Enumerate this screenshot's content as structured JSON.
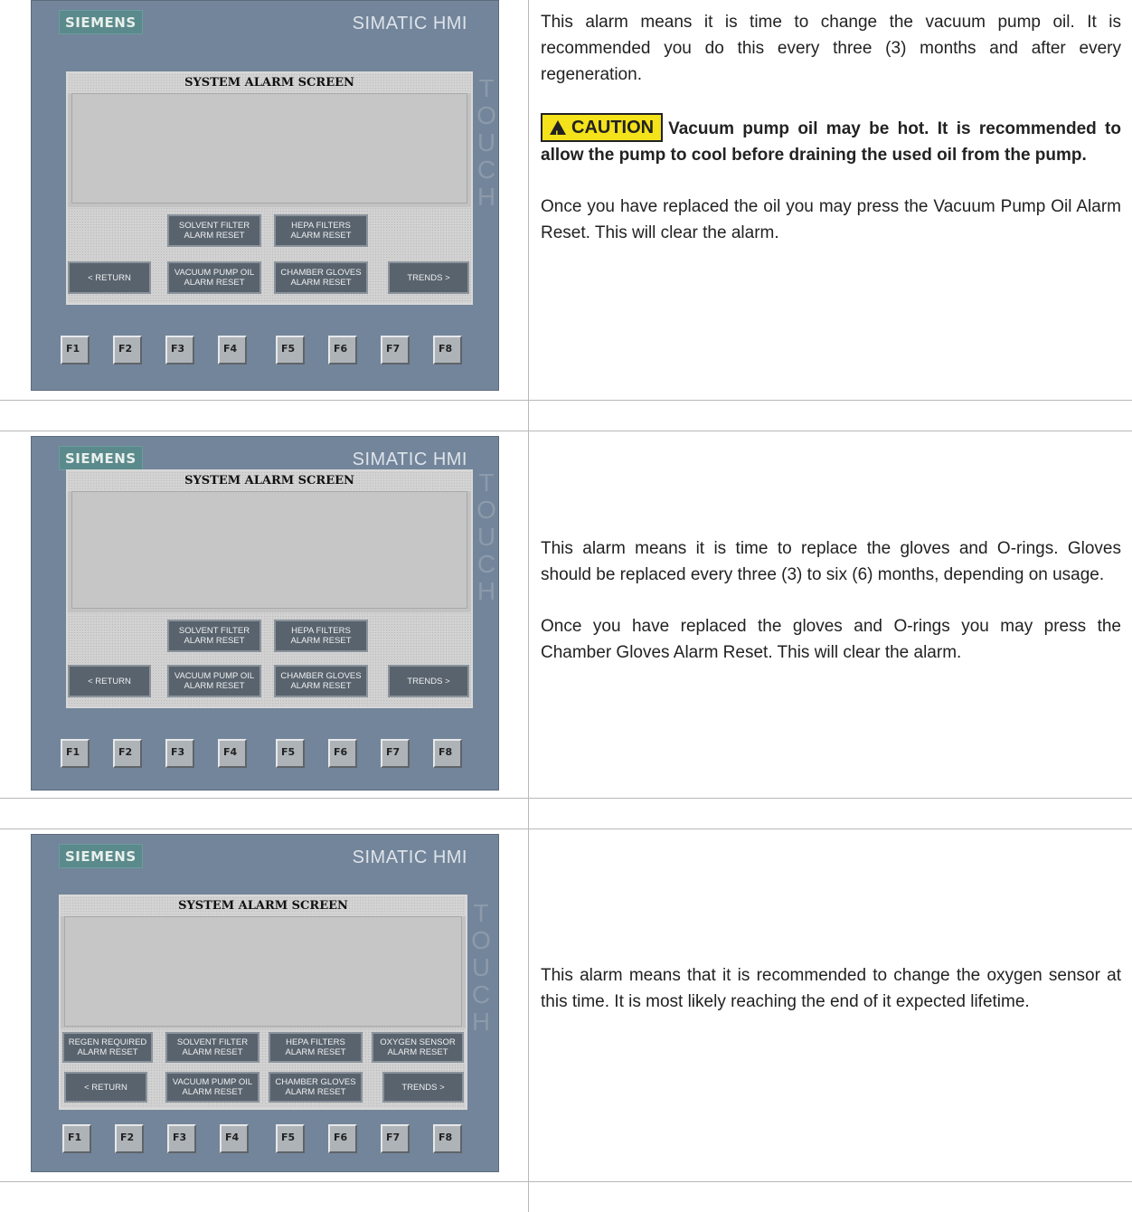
{
  "rows": [
    {
      "hmi": {
        "brand": "SIEMENS",
        "model": "SIMATIC HMI",
        "touch": "TOUCH",
        "screen_title": "SYSTEM ALARM SCREEN",
        "buttons": {
          "solvent": [
            "SOLVENT FILTER",
            "ALARM RESET"
          ],
          "hepa": [
            "HEPA FILTERS",
            "ALARM RESET"
          ],
          "ret": "< RETURN",
          "vacuum": [
            "VACUUM PUMP OIL",
            "ALARM RESET"
          ],
          "chamber": [
            "CHAMBER GLOVES",
            "ALARM RESET"
          ],
          "trends": "TRENDS >"
        },
        "fkeys": [
          "F1",
          "F2",
          "F3",
          "F4",
          "F5",
          "F6",
          "F7",
          "F8"
        ]
      },
      "text": {
        "p1": "This alarm means it is time to change the vacuum pump oil. It is recommended you do this every three (3) months and after every regeneration.",
        "caution_label": "CAUTION",
        "caution_text": "Vacuum pump oil may be hot. It is recommended to allow the pump to cool before draining the used oil from the pump.",
        "p2": "Once you have replaced the oil you may press the Vacuum Pump Oil Alarm Reset. This will clear the alarm."
      }
    },
    {
      "hmi": {
        "brand": "SIEMENS",
        "model": "SIMATIC HMI",
        "touch": "TOUCH",
        "screen_title": "SYSTEM ALARM SCREEN",
        "buttons": {
          "solvent": [
            "SOLVENT FILTER",
            "ALARM RESET"
          ],
          "hepa": [
            "HEPA FILTERS",
            "ALARM RESET"
          ],
          "ret": "< RETURN",
          "vacuum": [
            "VACUUM PUMP OIL",
            "ALARM RESET"
          ],
          "chamber": [
            "CHAMBER GLOVES",
            "ALARM RESET"
          ],
          "trends": "TRENDS >"
        },
        "fkeys": [
          "F1",
          "F2",
          "F3",
          "F4",
          "F5",
          "F6",
          "F7",
          "F8"
        ]
      },
      "text": {
        "p1": "This alarm means it is time to replace the gloves and O-rings. Gloves should be replaced every three (3) to six (6) months, depending on usage.",
        "p2": "Once you have replaced the gloves and O-rings you may press the Chamber Gloves Alarm Reset. This will clear the alarm."
      }
    },
    {
      "hmi": {
        "brand": "SIEMENS",
        "model": "SIMATIC HMI",
        "touch": "TOUCH",
        "screen_title": "SYSTEM ALARM SCREEN",
        "buttons": {
          "regen": [
            "REGEN REQUIRED",
            "ALARM RESET"
          ],
          "solvent": [
            "SOLVENT FILTER",
            "ALARM RESET"
          ],
          "hepa": [
            "HEPA FILTERS",
            "ALARM RESET"
          ],
          "oxygen": [
            "OXYGEN SENSOR",
            "ALARM RESET"
          ],
          "ret": "< RETURN",
          "vacuum": [
            "VACUUM PUMP OIL",
            "ALARM RESET"
          ],
          "chamber": [
            "CHAMBER GLOVES",
            "ALARM RESET"
          ],
          "trends": "TRENDS >"
        },
        "fkeys": [
          "F1",
          "F2",
          "F3",
          "F4",
          "F5",
          "F6",
          "F7",
          "F8"
        ]
      },
      "text": {
        "p1": "This alarm means that it is recommended to change the oxygen sensor at this time. It is most likely reaching the end of it expected lifetime."
      }
    }
  ]
}
